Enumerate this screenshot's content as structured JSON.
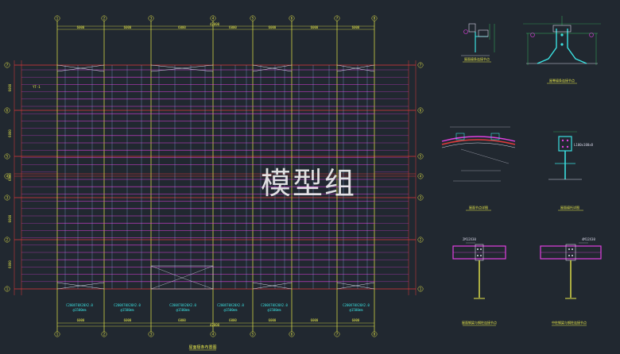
{
  "plan": {
    "grid_cols": [
      "1",
      "2",
      "3",
      "4",
      "5",
      "6",
      "7",
      "8"
    ],
    "grid_rows": [
      "7",
      "6",
      "5",
      "4",
      "3",
      "2",
      "1"
    ],
    "row_letter": "A",
    "col_spacings": [
      "6000",
      "6000",
      "6000",
      "6000",
      "6000",
      "6000",
      "6000"
    ],
    "overall_width": "42000",
    "side_dims": [
      "6000",
      "6000",
      "6000",
      "6000",
      "6000",
      "6000"
    ],
    "side_total": "36000",
    "purlin_specs": [
      {
        "spec": "C200X70X20X2.0",
        "spacing": "@1500mm"
      },
      {
        "spec": "C200X70X20X2.0",
        "spacing": "@1500mm"
      },
      {
        "spec": "C200X70X20X2.0",
        "spacing": "@1500mm"
      },
      {
        "spec": "C200X70X20X2.0",
        "spacing": "@1500mm"
      },
      {
        "spec": "C200X70X20X2.0",
        "spacing": "@1500mm"
      },
      {
        "spec": "C200X70X20X2.0",
        "spacing": "@1500mm"
      }
    ],
    "left_note": "YT-1",
    "title": "屋面檩条布置图"
  },
  "details": {
    "d1_title": "屋面檩条连接节点",
    "d2_title": "屋脊檩条连接节点",
    "d3_title": "屋面节点详图",
    "d4_title": "屋面檩托详图",
    "d4_note": "L100x100x8",
    "d5_label": "2M12X30",
    "d5_title": "屋面钢梁与钢柱连接节点",
    "d6_label": "4M12X30",
    "d6_title": "中柱钢梁与钢柱连接节点"
  },
  "watermark": "模型组",
  "colors": {
    "background": "#212830",
    "axis_yellow": "#e8e84a",
    "axis_red": "#e03a3a",
    "purlin_magenta": "#e040e0",
    "tie_white": "#d8d8e8",
    "dim_green": "#3ad86a",
    "detail_cyan": "#3ae0e0"
  }
}
